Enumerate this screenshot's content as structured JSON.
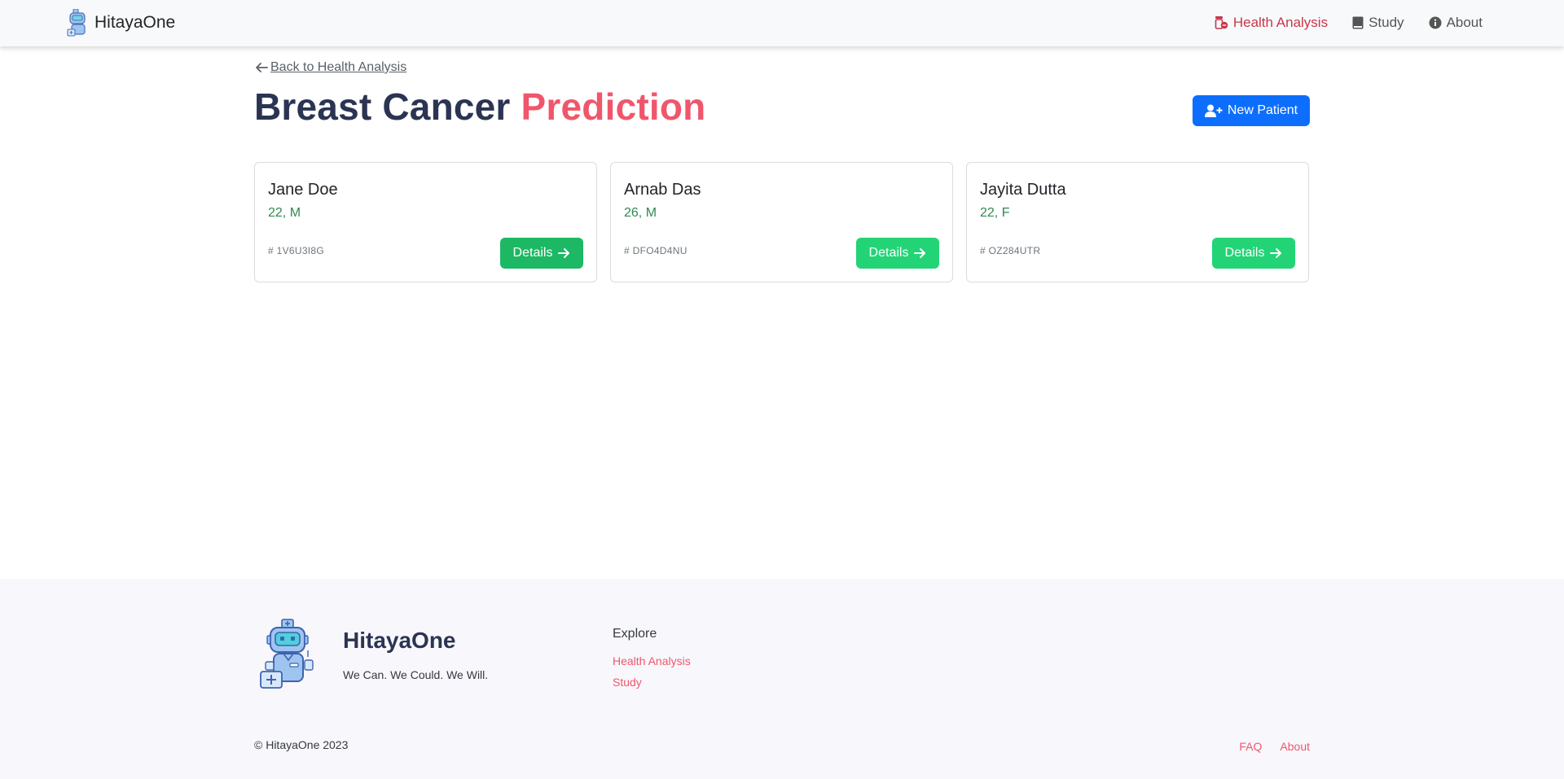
{
  "navbar": {
    "brand": "HitayaOne",
    "links": [
      {
        "label": "Health Analysis",
        "icon": "pill-bottle-icon",
        "active": true
      },
      {
        "label": "Study",
        "icon": "book-icon",
        "active": false
      },
      {
        "label": "About",
        "icon": "info-circle-icon",
        "active": false
      }
    ]
  },
  "main": {
    "back_link": "Back to Health Analysis",
    "title_main": "Breast Cancer",
    "title_accent": "Prediction",
    "new_patient_label": "New Patient",
    "patients": [
      {
        "name": "Jane Doe",
        "meta": "22, M",
        "id": "# 1V6U3I8G",
        "button": "Details",
        "button_color": "#1cb863"
      },
      {
        "name": "Arnab Das",
        "meta": "26, M",
        "id": "# DFO4D4NU",
        "button": "Details",
        "button_color": "#22d476"
      },
      {
        "name": "Jayita Dutta",
        "meta": "22, F",
        "id": "# OZ284UTR",
        "button": "Details",
        "button_color": "#22d476"
      }
    ]
  },
  "footer": {
    "brand": "HitayaOne",
    "tagline": "We Can. We Could. We Will.",
    "explore_title": "Explore",
    "explore_links": [
      "Health Analysis",
      "Study"
    ],
    "copyright": "© HitayaOne 2023",
    "bottom_links": [
      "FAQ",
      "About"
    ]
  },
  "colors": {
    "accent": "#f0566b",
    "primary": "#0d6efd",
    "title": "#2b3452",
    "active_nav": "#c8364a",
    "meta_green": "#2f8a52"
  }
}
